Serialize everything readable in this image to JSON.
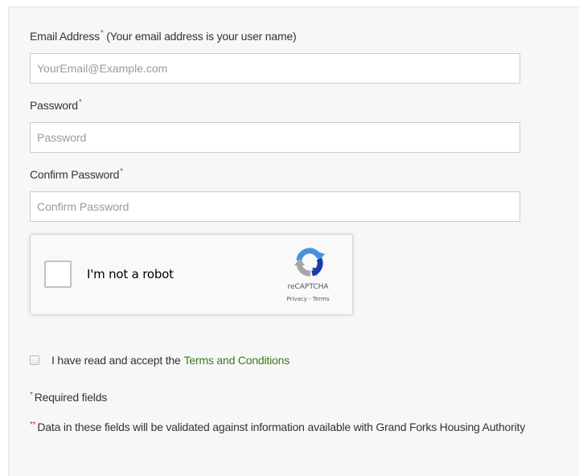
{
  "form": {
    "email": {
      "label": "Email Address",
      "required_mark": "*",
      "hint": " (Your email address is your user name)",
      "placeholder": "YourEmail@Example.com",
      "value": ""
    },
    "password": {
      "label": "Password",
      "required_mark": "*",
      "placeholder": "Password",
      "value": ""
    },
    "confirm_password": {
      "label": "Confirm Password",
      "required_mark": "*",
      "placeholder": "Confirm Password",
      "value": ""
    }
  },
  "recaptcha": {
    "label": "I'm not a robot",
    "brand": "reCAPTCHA",
    "privacy": "Privacy",
    "separator": " - ",
    "terms": "Terms",
    "icon": "recaptcha-logo-icon",
    "colors": {
      "blue": "#4a90e2",
      "dark_blue": "#1c3aa9",
      "grey": "#a6a6a6"
    }
  },
  "terms": {
    "text": "I have read and accept the",
    "link": "Terms and Conditions",
    "link_color": "#3c7a1f"
  },
  "notes": {
    "required_mark": "*",
    "required": "Required fields",
    "validated_mark": "**",
    "validated": "Data in these fields will be validated against information available with Grand Forks Housing Authority"
  },
  "colors": {
    "panel_bg": "#f7f7f7",
    "required_star": "#c0392b"
  }
}
